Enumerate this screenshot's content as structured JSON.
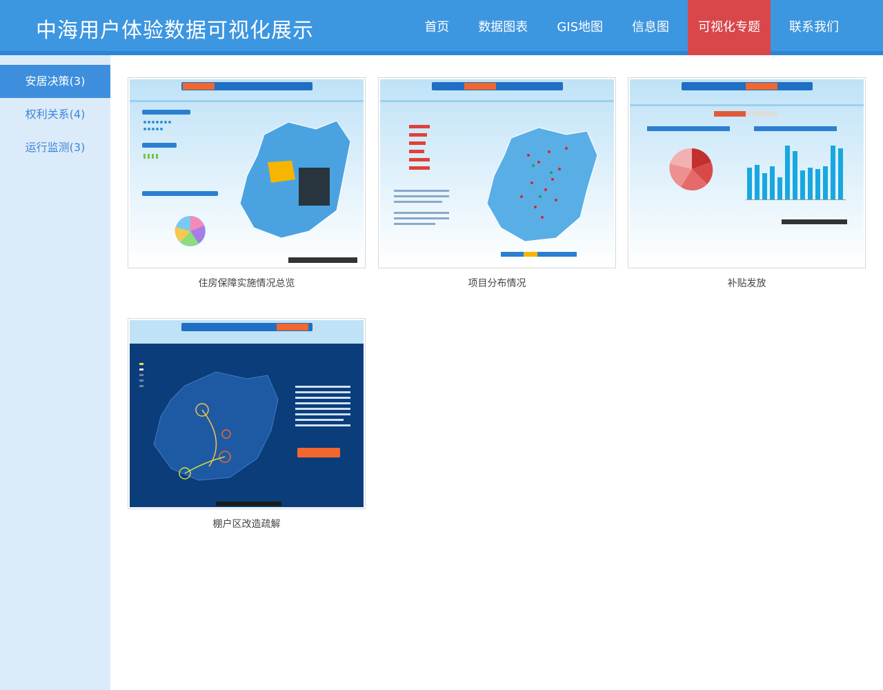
{
  "header": {
    "title": "中海用户体验数据可视化展示",
    "nav": [
      "首页",
      "数据图表",
      "GIS地图",
      "信息图",
      "可视化专题",
      "联系我们"
    ],
    "active_nav": "可视化专题"
  },
  "sidebar": {
    "items": [
      {
        "label": "安居决策(3)"
      },
      {
        "label": "权利关系(4)"
      },
      {
        "label": "运行监测(3)"
      }
    ]
  },
  "cards": [
    {
      "caption": "住房保障实施情况总览"
    },
    {
      "caption": "项目分布情况"
    },
    {
      "caption": "补贴发放"
    },
    {
      "caption": "棚户区改造疏解"
    }
  ],
  "colors": {
    "header_blue": "#3d96e0",
    "active_red": "#d9474b",
    "sidebar_bg": "#dcebfa",
    "sidebar_active": "#3d8fdd"
  }
}
